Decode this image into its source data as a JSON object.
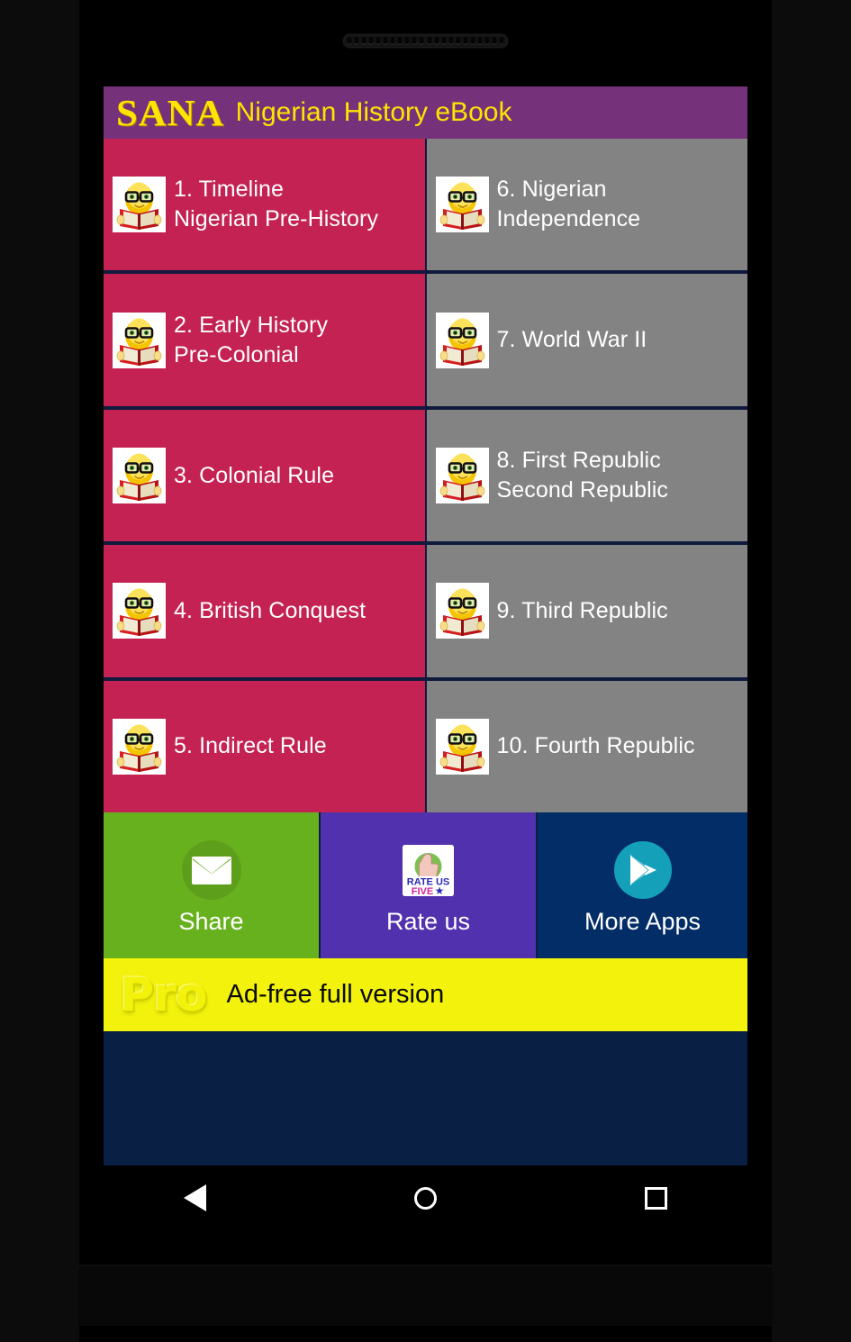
{
  "device": {
    "speaker_icon": "speaker-grille-icon",
    "hole_count": 22
  },
  "header": {
    "brand": "SANA",
    "title": "Nigerian History eBook",
    "background_color": "#75327b",
    "text_color": "#ffe400"
  },
  "chapters": {
    "icon_name": "reading-character-icon",
    "left_color": "#c42253",
    "right_color": "#838383",
    "left": [
      {
        "label": "1. Timeline\nNigerian Pre-History"
      },
      {
        "label": "2. Early History\nPre-Colonial"
      },
      {
        "label": "3. Colonial Rule"
      },
      {
        "label": "4. British Conquest"
      },
      {
        "label": "5. Indirect Rule"
      }
    ],
    "right": [
      {
        "label": "6. Nigerian\nIndependence"
      },
      {
        "label": "7. World War II"
      },
      {
        "label": "8. First Republic\nSecond Republic"
      },
      {
        "label": "9. Third Republic"
      },
      {
        "label": "10. Fourth Republic"
      }
    ]
  },
  "actions": {
    "share": {
      "label": "Share",
      "icon": "envelope-icon",
      "color": "#68b11e"
    },
    "rate": {
      "label": "Rate us",
      "icon": "rate-us-badge-icon",
      "color": "#5131ad",
      "badge_line1": "RATE US",
      "badge_line2": "FIVE",
      "badge_star": "★"
    },
    "more_apps": {
      "label": "More Apps",
      "icon": "play-store-icon",
      "color": "#032d66"
    }
  },
  "pro_banner": {
    "logo": "Pro",
    "text": "Ad-free full version",
    "background_color": "#f2f20d"
  },
  "nav_bar": {
    "back": "back-icon",
    "home": "home-icon",
    "recents": "recents-icon"
  }
}
